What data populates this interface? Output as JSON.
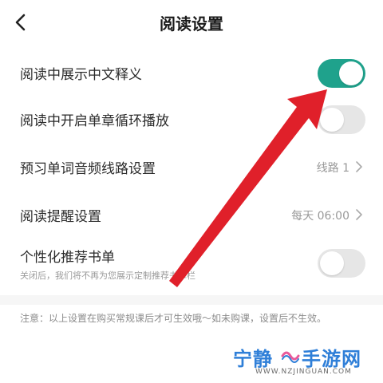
{
  "header": {
    "title": "阅读设置",
    "back_icon": "chevron-left-icon"
  },
  "settings": [
    {
      "label": "阅读中展示中文释义",
      "control": "toggle",
      "enabled": true,
      "toggle_color": "#1fa28c"
    },
    {
      "label": "阅读中开启单章循环播放",
      "control": "toggle",
      "enabled": false
    },
    {
      "label": "预习单词音频线路设置",
      "control": "select",
      "value": "线路 1"
    },
    {
      "label": "阅读提醒设置",
      "control": "select",
      "value": "每天 06:00"
    },
    {
      "label": "个性化推荐书单",
      "control": "toggle",
      "enabled": false,
      "description": "关闭后，我们将不再为您展示定制推荐书单栏"
    }
  ],
  "notice": "注意：以上设置在购买常规课后才可生效哦～如未购课，设置后不生效。",
  "annotation": {
    "color": "#e0202a",
    "icon": "red-arrow-pointer"
  },
  "watermark": {
    "text_left": "宁静",
    "text_right": "手游网",
    "url": "WWW.NZJINGUAN.COM",
    "color": "#2f7fd8"
  }
}
